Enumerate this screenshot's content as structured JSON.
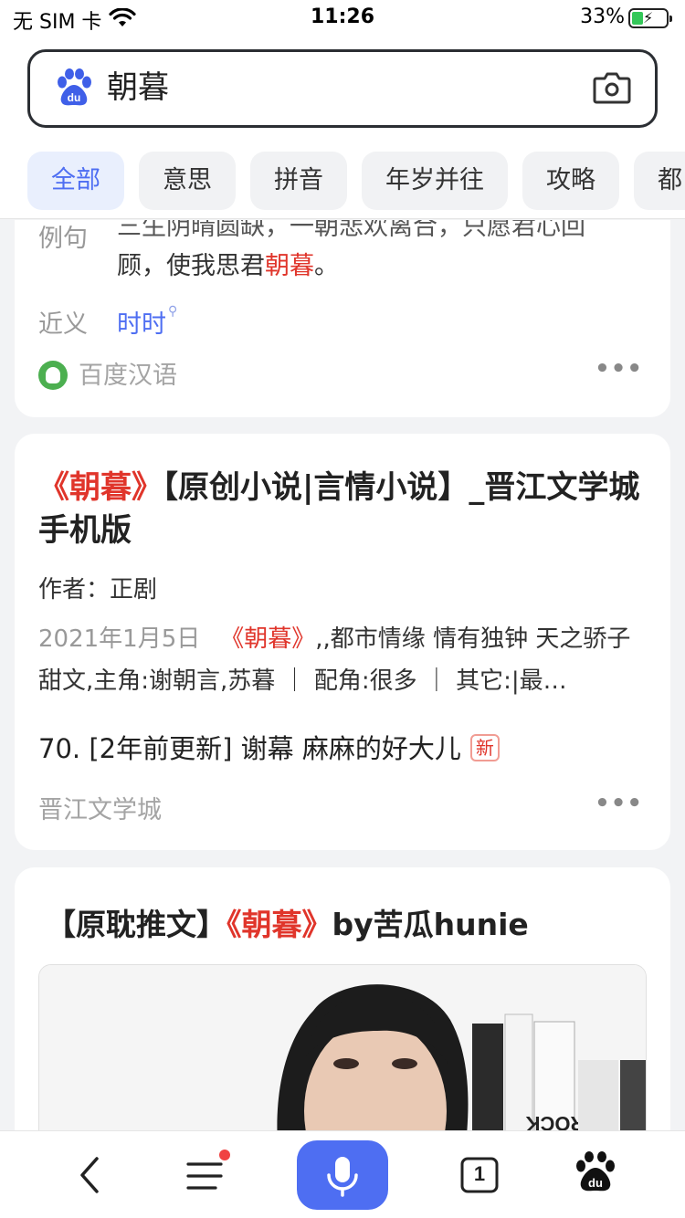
{
  "status_bar": {
    "carrier": "无 SIM 卡",
    "time": "11:26",
    "battery_percent": "33%",
    "battery_level": 0.33,
    "wifi_icon": "wifi-icon",
    "battery_icon": "battery-charging-icon"
  },
  "search": {
    "query": "朝暮",
    "logo_icon": "baidu-paw-icon",
    "camera_icon": "camera-icon"
  },
  "tabs": [
    {
      "label": "全部",
      "active": true
    },
    {
      "label": "意思",
      "active": false
    },
    {
      "label": "拼音",
      "active": false
    },
    {
      "label": "年岁并往",
      "active": false
    },
    {
      "label": "攻略",
      "active": false
    },
    {
      "label": "都",
      "active": false
    }
  ],
  "card1": {
    "example_label": "例句",
    "example_line1": "三生阴晴圆缺，一朝悲欢离合，只愿君心回",
    "example_line2_pre": "顾，使我思君",
    "example_line2_hl": "朝暮",
    "example_line2_post": "。",
    "synonym_label": "近义",
    "synonym": "时时",
    "source": "百度汉语",
    "more": "•••"
  },
  "card2": {
    "title_hl": "《朝暮》",
    "title_rest": "【原创小说|言情小说】_晋江文学城手机版",
    "author": "作者：正剧",
    "date": "2021年1月5日",
    "desc_hl": "《朝暮》",
    "desc_rest": ",,都市情缘 情有独钟 天之骄子 甜文,主角:谢朝言,苏暮 ｜ 配角:很多 ｜ 其它:|最…",
    "update": "70. [2年前更新] 谢幕 麻麻的好大儿",
    "badge": "新",
    "source": "晋江文学城",
    "more": "•••"
  },
  "card3": {
    "title_pre": "【原耽推文】",
    "title_hl": "《朝暮》",
    "title_post": "by苦瓜hunie"
  },
  "bottom_bar": {
    "back_icon": "back-icon",
    "menu_icon": "menu-icon",
    "mic_icon": "microphone-icon",
    "tabs_count": "1",
    "home_icon": "baidu-paw-icon"
  },
  "colors": {
    "accent": "#4e6ef2",
    "highlight": "#e0352b",
    "background": "#f2f3f5"
  }
}
